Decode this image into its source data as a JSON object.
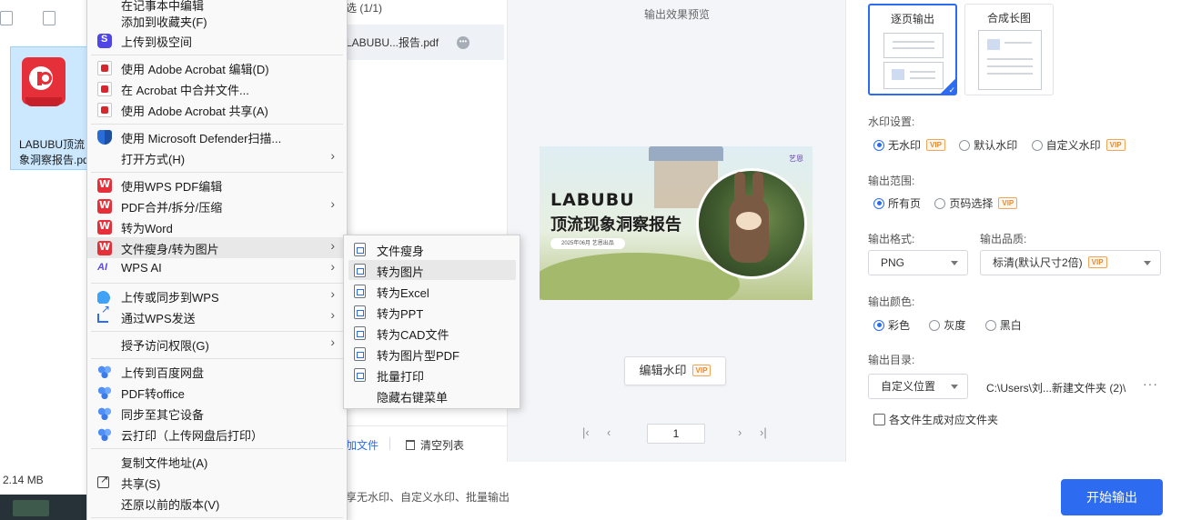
{
  "explorer": {
    "file_name_line1": "LABUBU顶流",
    "file_name_line2": "象洞察报告.pd",
    "file_size": "2.14 MB"
  },
  "converter": {
    "list_header": "选 (1/1)",
    "list_file": "LABUBU...报告.pdf",
    "add_file": "加文件",
    "clear_list": "清空列表",
    "preview_title": "输出效果预览",
    "banner_title_1": "LABUBU",
    "banner_title_2": "顶流现象洞察报告",
    "banner_pill": "2025年06月 艺恩出品",
    "banner_badge": "艺恩",
    "edit_watermark": "编辑水印",
    "vip": "VIP",
    "page_number": "1",
    "tip": "享无水印、自定义水印、批量输出"
  },
  "settings": {
    "mode_page": "逐页输出",
    "mode_long": "合成长图",
    "watermark_label": "水印设置:",
    "watermark_options": [
      "无水印",
      "默认水印",
      "自定义水印"
    ],
    "range_label": "输出范围:",
    "range_options": [
      "所有页",
      "页码选择"
    ],
    "format_label": "输出格式:",
    "format_value": "PNG",
    "quality_label": "输出品质:",
    "quality_value": "标清(默认尺寸2倍)",
    "color_label": "输出颜色:",
    "color_options": [
      "彩色",
      "灰度",
      "黑白"
    ],
    "dir_label": "输出目录:",
    "dir_value": "自定义位置",
    "dir_path": "C:\\Users\\刘...新建文件夹 (2)\\",
    "dir_more": "···",
    "per_file_folder": "各文件生成对应文件夹",
    "start_button": "开始输出"
  },
  "context_menu": {
    "items": [
      {
        "label": "在记事本中编辑",
        "icon": "notepad-icon"
      },
      {
        "label": "添加到收藏夹(F)",
        "icon": ""
      },
      {
        "label": "上传到极空间",
        "icon": "jikong-icon"
      },
      {
        "label": "使用 Adobe Acrobat 编辑(D)",
        "icon": "acrobat-icon"
      },
      {
        "label": "在 Acrobat 中合并文件...",
        "icon": "acrobat-icon"
      },
      {
        "label": "使用 Adobe Acrobat 共享(A)",
        "icon": "acrobat-icon"
      },
      {
        "label": "使用 Microsoft Defender扫描...",
        "icon": "defender-shield-icon"
      },
      {
        "label": "打开方式(H)",
        "icon": ""
      },
      {
        "label": "使用WPS PDF编辑",
        "icon": "wps-icon"
      },
      {
        "label": "PDF合并/拆分/压缩",
        "icon": "wps-icon"
      },
      {
        "label": "转为Word",
        "icon": "wps-icon"
      },
      {
        "label": "文件瘦身/转为图片",
        "icon": "wps-icon"
      },
      {
        "label": "WPS AI",
        "icon": "wps-ai-icon"
      },
      {
        "label": "上传或同步到WPS",
        "icon": "cloud-icon"
      },
      {
        "label": "通过WPS发送",
        "icon": "share-icon"
      },
      {
        "label": "授予访问权限(G)",
        "icon": ""
      },
      {
        "label": "上传到百度网盘",
        "icon": "baidu-icon"
      },
      {
        "label": "PDF转office",
        "icon": "baidu-icon"
      },
      {
        "label": "同步至其它设备",
        "icon": "baidu-icon"
      },
      {
        "label": "云打印（上传网盘后打印）",
        "icon": "baidu-icon"
      },
      {
        "label": "复制文件地址(A)",
        "icon": ""
      },
      {
        "label": "共享(S)",
        "icon": "share-os-icon"
      },
      {
        "label": "还原以前的版本(V)",
        "icon": ""
      }
    ]
  },
  "submenu": {
    "items": [
      "文件瘦身",
      "转为图片",
      "转为Excel",
      "转为PPT",
      "转为CAD文件",
      "转为图片型PDF",
      "批量打印",
      "隐藏右键菜单"
    ]
  }
}
